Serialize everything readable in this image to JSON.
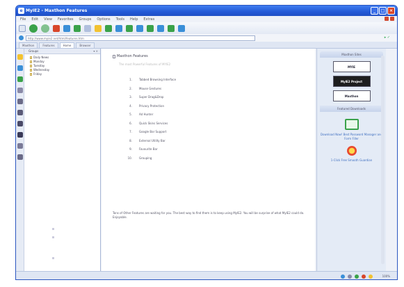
{
  "window": {
    "title": "MyIE2 - Maxthon Features"
  },
  "menubar": {
    "items": [
      "File",
      "Edit",
      "View",
      "Favorites",
      "Groups",
      "Options",
      "Tools",
      "Help",
      "Extras"
    ]
  },
  "address": {
    "url": "http://www.myie2.net/html/features.htm"
  },
  "tabs": [
    {
      "label": "Maxthon"
    },
    {
      "label": "Features"
    },
    {
      "label": "Home"
    },
    {
      "label": "Browser"
    }
  ],
  "sidebar": {
    "header": "Groups",
    "items": [
      "Daily News",
      "Monday",
      "Tuesday",
      "Wednesday",
      "Friday"
    ]
  },
  "content": {
    "title": "Maxthon Features",
    "subtitle": "The most Powerful Features of MYIE2",
    "features": [
      {
        "num": "1.",
        "label": "Tabbed Browsing Interface"
      },
      {
        "num": "2.",
        "label": "Mouse Gestures"
      },
      {
        "num": "3.",
        "label": "Super Drag&Drop"
      },
      {
        "num": "4.",
        "label": "Privacy Protection"
      },
      {
        "num": "5.",
        "label": "Ad Hunter"
      },
      {
        "num": "6.",
        "label": "Quick Skins Services"
      },
      {
        "num": "7.",
        "label": "Google Bar Support"
      },
      {
        "num": "8.",
        "label": "External Utility Bar"
      },
      {
        "num": "9.",
        "label": "Favourite Bar"
      },
      {
        "num": "10.",
        "label": "Grouping"
      }
    ],
    "note": "Tons of Other Features are waiting for you. The best way to find them is to keep using MyIE2. You will be surprise of what MyIE2 could do. Enjoyable."
  },
  "rightpanel": {
    "header": "Maxthon Sites",
    "badges": [
      "MYIE",
      "MyIE2 Project",
      "Maxthon"
    ],
    "section": "Featured Downloads",
    "download_text": "Download Now! Best Password Manager and Form Filler",
    "star_text": "1-Click Free Smooth Guardian"
  },
  "statusbar": {
    "zoom": "100%"
  }
}
